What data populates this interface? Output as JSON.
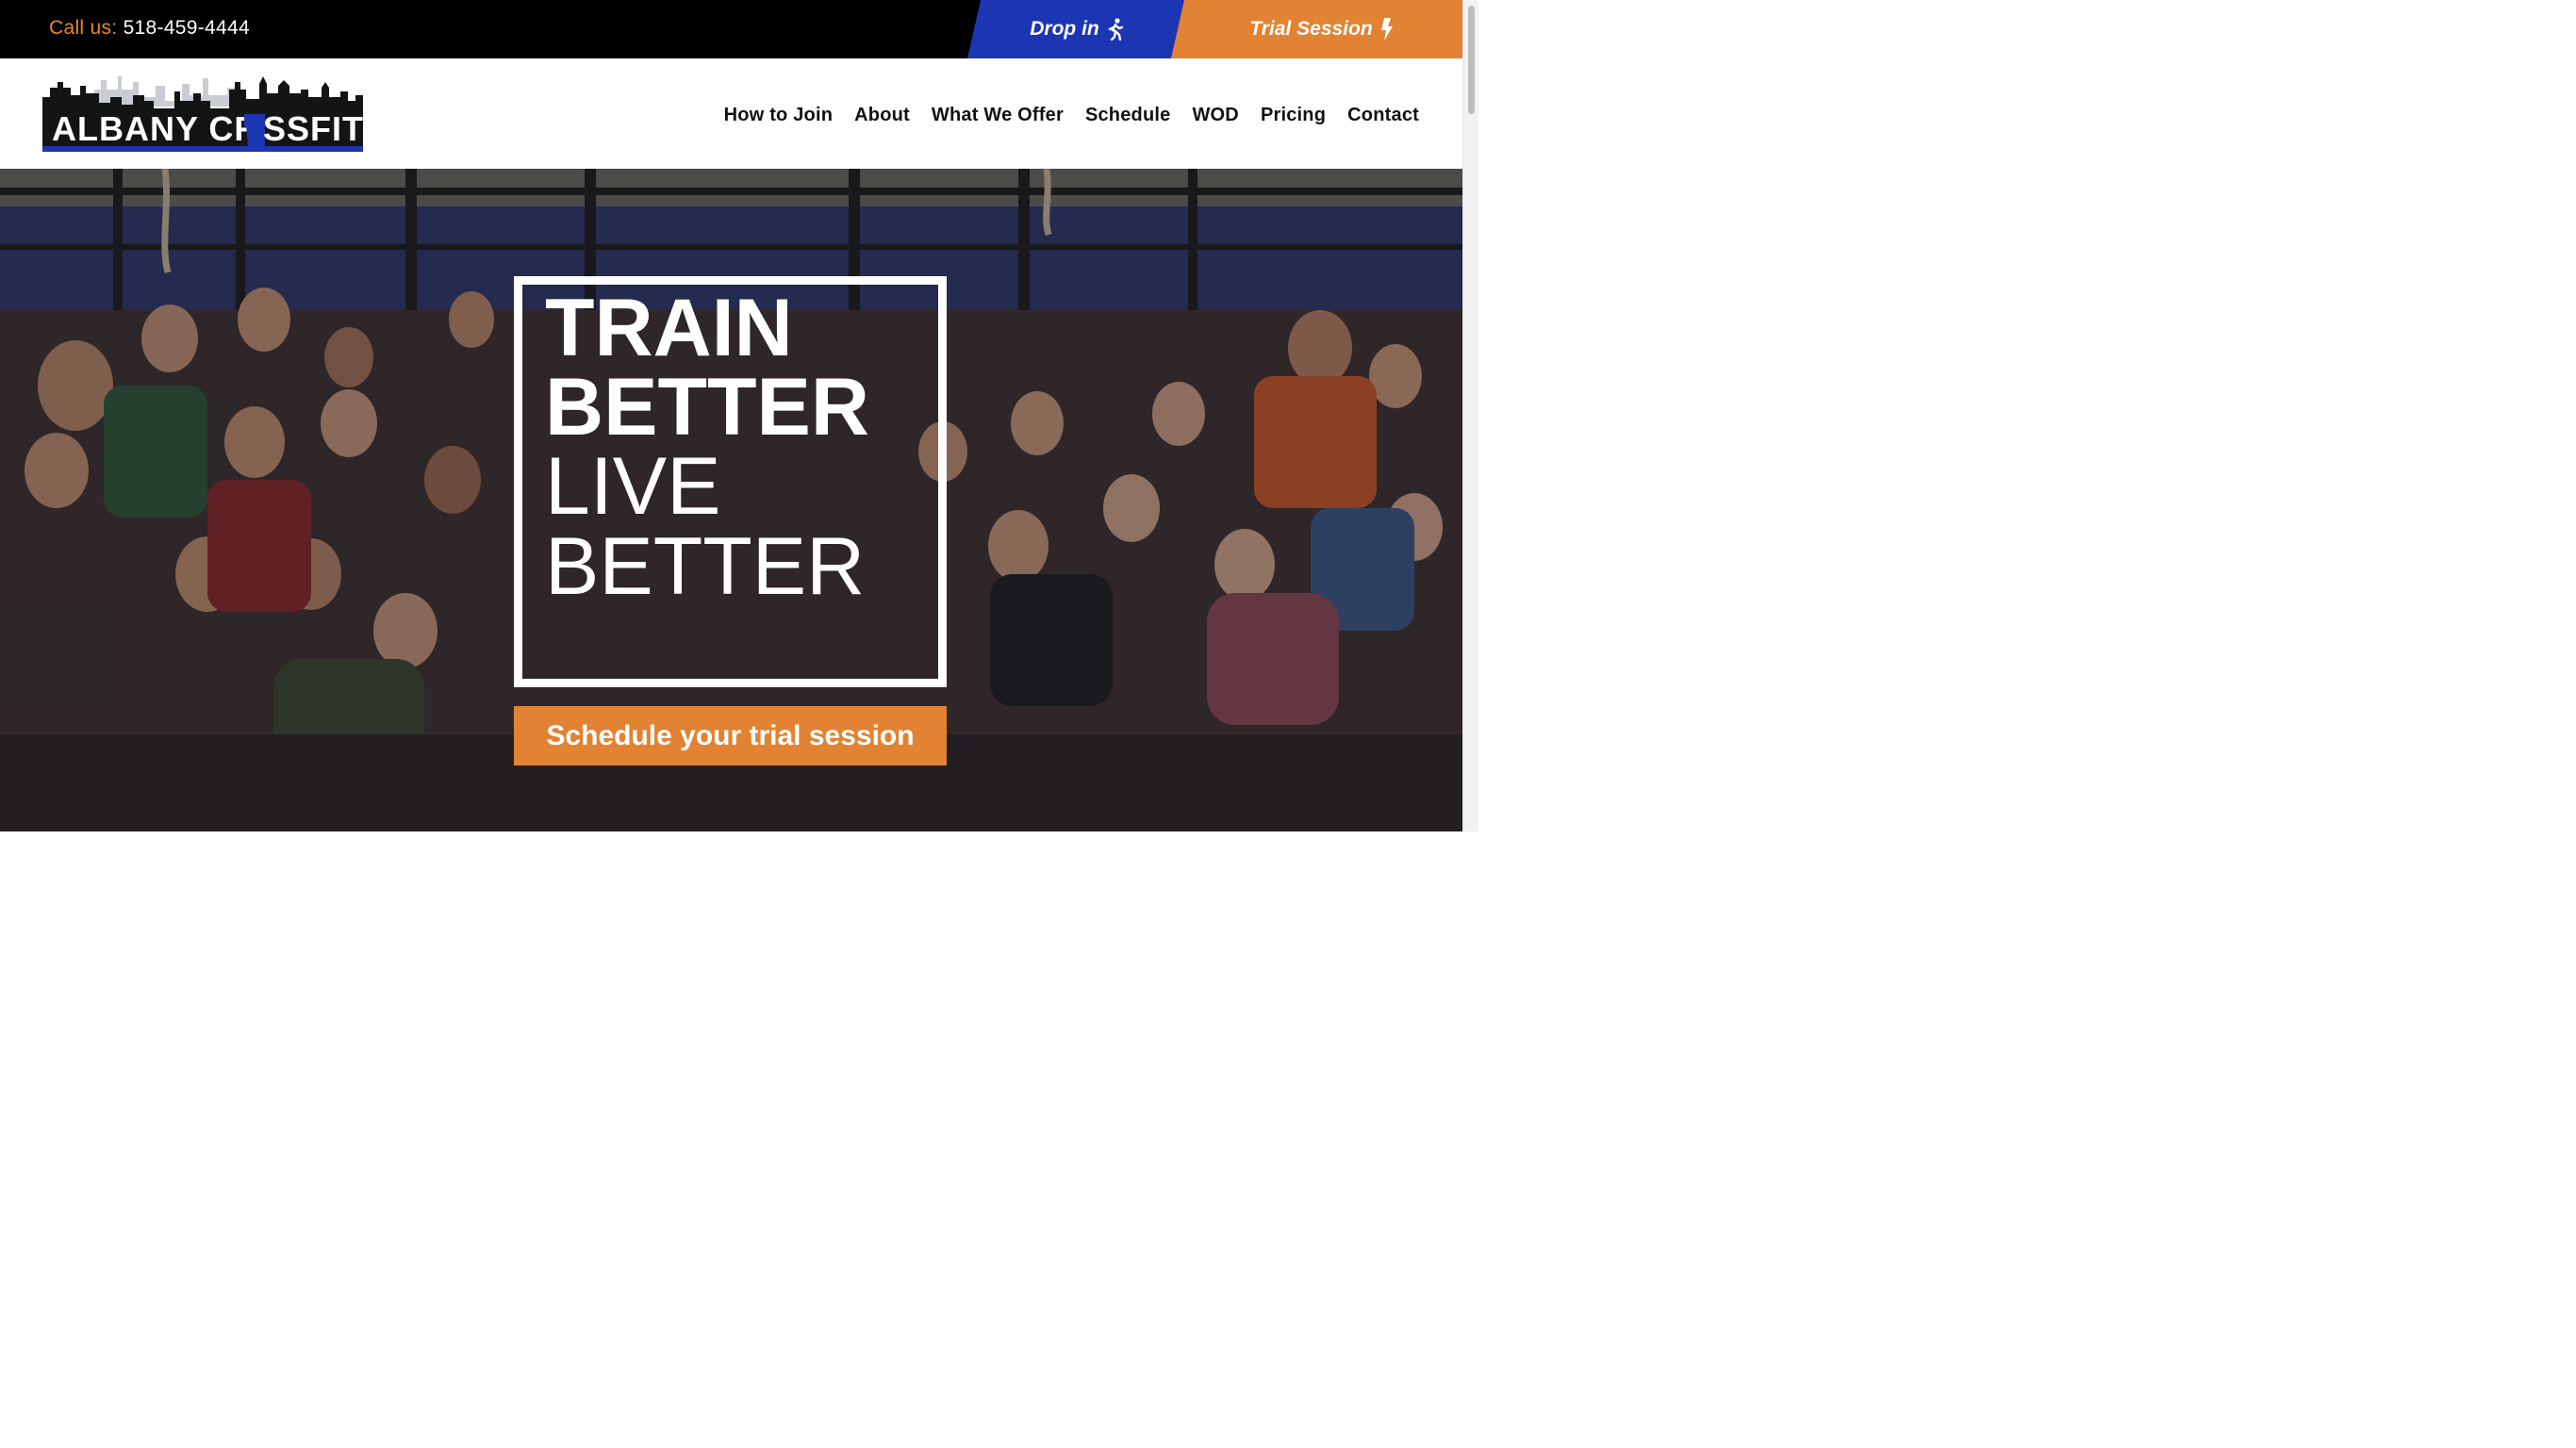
{
  "topbar": {
    "call_label": "Call us:",
    "phone": "518-459-4444",
    "dropin_label": "Drop in",
    "trial_label": "Trial Session",
    "dropin_icon": "walking-person-icon",
    "trial_icon": "lightning-bolt-icon"
  },
  "header": {
    "logo_text_left": "ALBANY CR",
    "logo_text_right": "SSFIT",
    "nav": [
      "How to Join",
      "About",
      "What We Offer",
      "Schedule",
      "WOD",
      "Pricing",
      "Contact"
    ]
  },
  "hero": {
    "line1": "TRAIN",
    "line2": "BETTER",
    "line3": "LIVE",
    "line4": "BETTER",
    "cta_label": "Schedule your trial session"
  },
  "colors": {
    "accent_orange": "#e18333",
    "accent_blue": "#1c35b3",
    "topbar_bg": "#000000"
  }
}
